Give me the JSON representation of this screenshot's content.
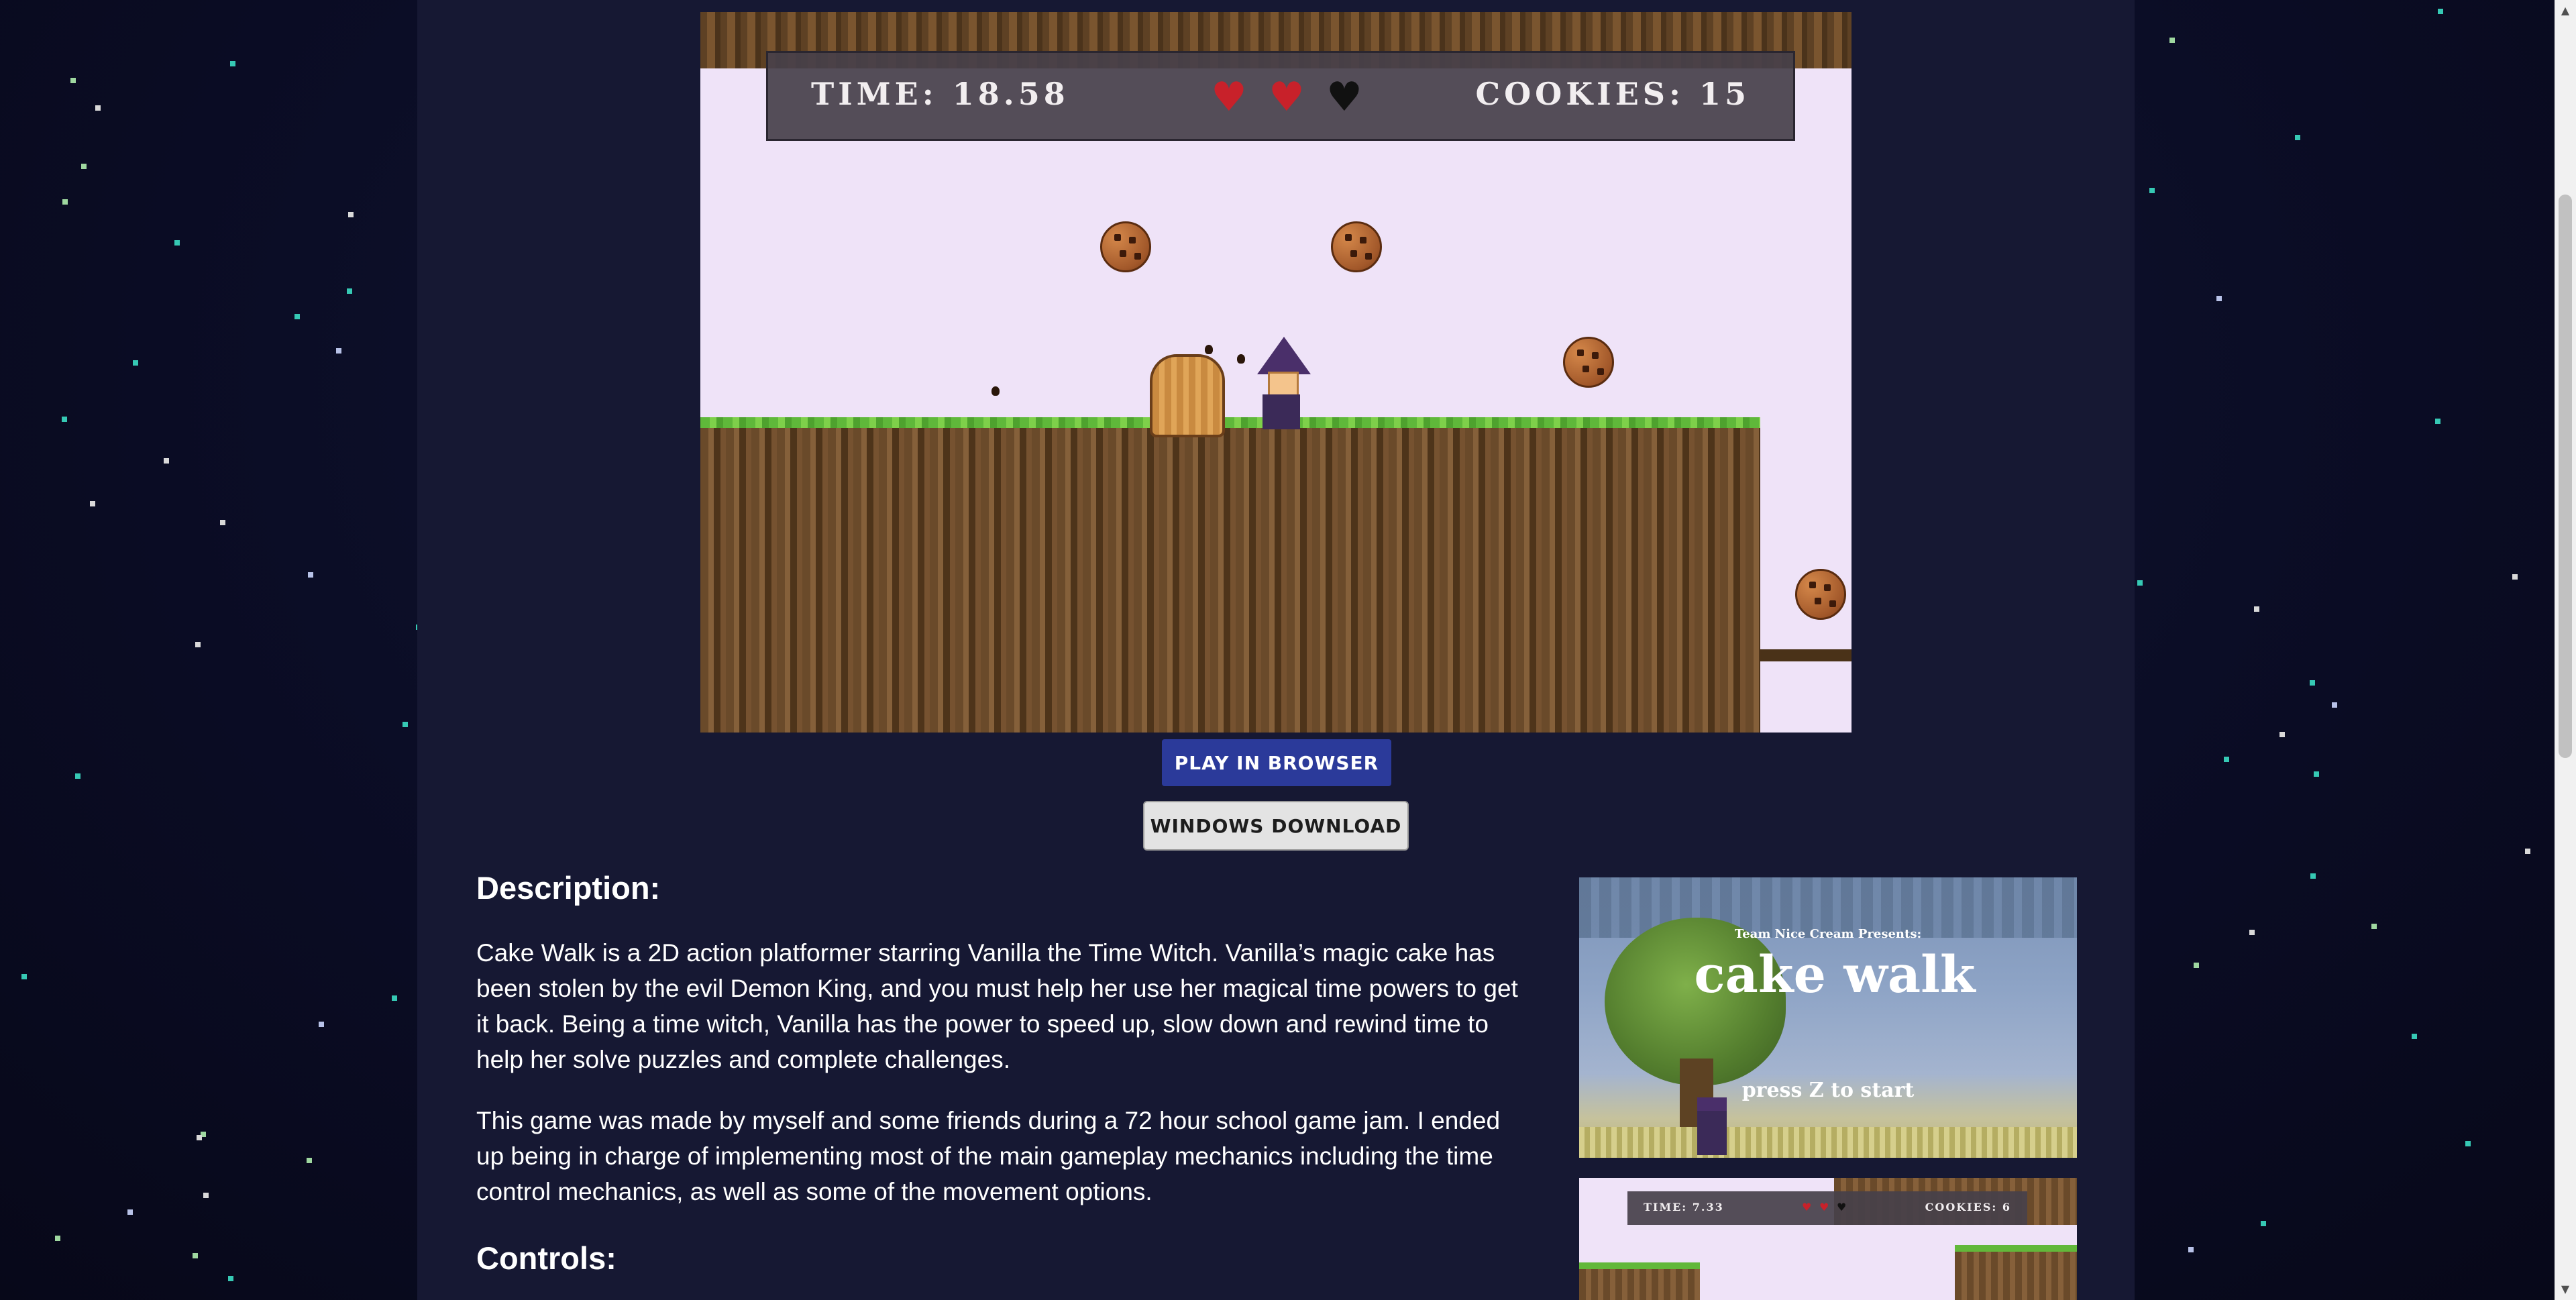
{
  "hud": {
    "time_text": "TIME: 18.58",
    "cookies_text": "COOKIES: 15",
    "hearts": [
      {
        "icon": "heart-full-icon",
        "color": "#c8212a"
      },
      {
        "icon": "heart-full-icon",
        "color": "#c8212a"
      },
      {
        "icon": "heart-empty-icon",
        "color": "#111111"
      }
    ]
  },
  "buttons": {
    "play_label": "PLAY IN BROWSER",
    "download_label": "WINDOWS DOWNLOAD"
  },
  "description": {
    "heading": "Description:",
    "paragraph_1": "Cake Walk is a 2D action platformer starring Vanilla the Time Witch. Vanilla’s magic cake has been stolen by the evil Demon King, and you must help her use her magical time powers to get it back. Being a time witch, Vanilla has the power to speed up, slow down and rewind time to help her solve puzzles and complete challenges.",
    "paragraph_2": "This game was made by myself and some friends during a 72 hour school game jam. I ended up being in charge of implementing most of the main gameplay mechanics including the time control mechanics, as well as some of the movement options."
  },
  "controls": {
    "heading": "Controls:"
  },
  "screenshots": {
    "title_screen": {
      "presents": "Team Nice Cream Presents:",
      "title": "cake walk",
      "prompt": "press Z to start"
    },
    "gameplay": {
      "time_text": "TIME: 7.33",
      "cookies_text": "COOKIES: 6"
    }
  },
  "colors": {
    "background": "#0a0c24",
    "column": "#161833",
    "play_button": "#2b3a9a",
    "download_button": "#e3e3e3"
  }
}
